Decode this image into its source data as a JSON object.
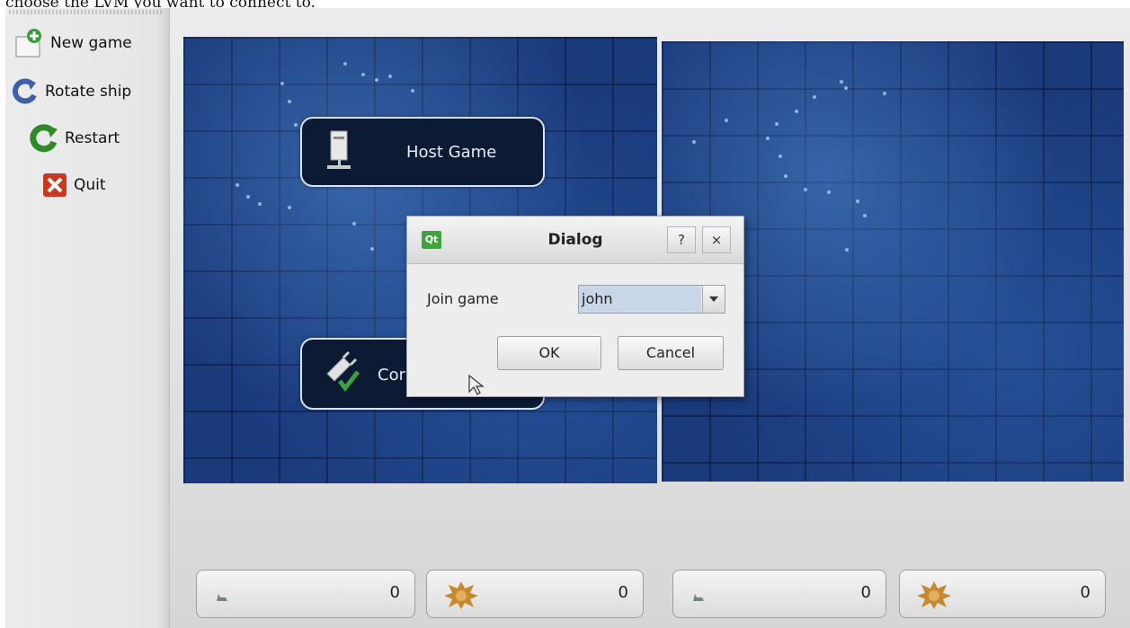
{
  "caption": "choose the LVM you want to connect to.",
  "toolbar": {
    "new_game": "New game",
    "rotate_ship": "Rotate ship",
    "restart": "Restart",
    "quit": "Quit"
  },
  "menu": {
    "host_game": "Host Game",
    "connect_game": "Cor"
  },
  "dialog": {
    "logo": "Qt",
    "title": "Dialog",
    "help": "?",
    "close": "×",
    "join_label": "Join game",
    "join_value": "john",
    "ok": "OK",
    "cancel": "Cancel"
  },
  "counters": [
    {
      "value": "0",
      "icon": "ship-icon"
    },
    {
      "value": "0",
      "icon": "explosion-icon"
    },
    {
      "value": "0",
      "icon": "ship-icon"
    },
    {
      "value": "0",
      "icon": "explosion-icon"
    }
  ],
  "colors": {
    "board": "#1a3a7c",
    "menu_button": "#0c1a33",
    "qt_green": "#41a33e"
  }
}
